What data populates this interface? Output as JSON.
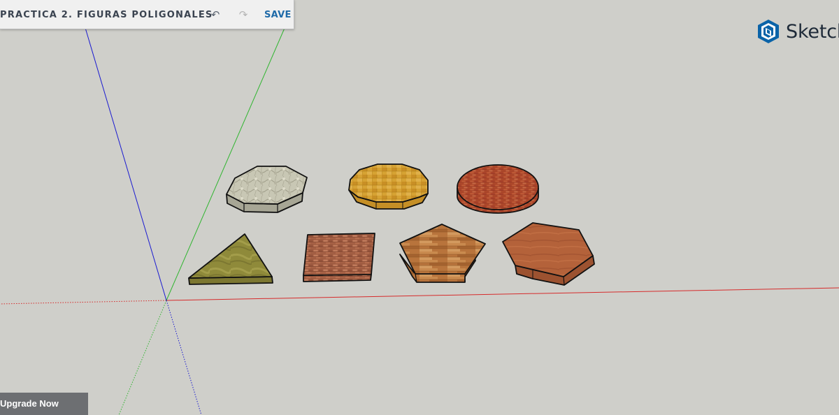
{
  "header": {
    "title": "PRACTICA 2. FIGURAS POLIGONALES",
    "undo_icon": "undo-icon",
    "redo_icon": "redo-icon",
    "save_label": "SAVE"
  },
  "brand": {
    "icon": "sketchup-logo-icon",
    "text": "SketchUp"
  },
  "upgrade": {
    "label": "Upgrade Now"
  },
  "colors": {
    "background": "#cfcfca",
    "axis_red": "#d62b2b",
    "axis_green": "#2fb52f",
    "axis_blue": "#1b1bd0",
    "save_blue": "#1f6aa8",
    "brand_blue": "#0a63a8"
  },
  "scene": {
    "shapes": [
      {
        "name": "octagon-stone",
        "kind": "octagon",
        "material": "stone"
      },
      {
        "name": "decagon-gold-wood",
        "kind": "decagon",
        "material": "gold-wood"
      },
      {
        "name": "circle-brick",
        "kind": "circle",
        "material": "brick"
      },
      {
        "name": "triangle-olive",
        "kind": "triangle",
        "material": "olive"
      },
      {
        "name": "square-brick",
        "kind": "square",
        "material": "brick"
      },
      {
        "name": "pentagon-wood",
        "kind": "pentagon",
        "material": "wood-plank"
      },
      {
        "name": "hexagon-wood",
        "kind": "hexagon",
        "material": "wood"
      }
    ]
  }
}
